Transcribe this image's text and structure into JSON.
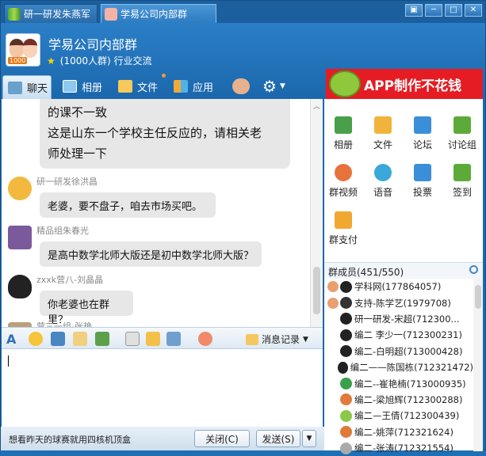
{
  "tabs": [
    {
      "label": "研一研发朱燕军"
    },
    {
      "label": "学易公司内部群"
    }
  ],
  "header": {
    "group_name": "学易公司内部群",
    "info": "(1000人群) 行业交流",
    "badge": "1000"
  },
  "toolbar": {
    "chat": "聊天",
    "album": "相册",
    "file": "文件",
    "apps": "应用"
  },
  "ad_banner": "APP制作不花钱",
  "messages": [
    {
      "sender": "",
      "text": [
        "的课不一致",
        "这是山东一个学校主任反应的，请相关老",
        "师处理一下"
      ]
    },
    {
      "sender": "研一研发徐洪昌",
      "text": "老婆，要不盘子，咱去市场买吧。"
    },
    {
      "sender": "精品组朱春光",
      "text": "是高中数学北师大版还是初中数学北师大版？"
    },
    {
      "sender": "zxxk营八-刘晶晶",
      "text": "你老婆也在群里？"
    },
    {
      "sender": "营三一组-张艳",
      "text": ""
    }
  ],
  "input": {
    "history_label": "消息记录"
  },
  "footer": {
    "ad_text": "想看昨天的球赛就用四核机顶盒",
    "close_label": "关闭(C)",
    "send_label": "发送(S)"
  },
  "apps": [
    {
      "label": "相册",
      "icon": "album-icon",
      "color": "#4aa04a"
    },
    {
      "label": "文件",
      "icon": "folder-icon",
      "color": "#f0b43c"
    },
    {
      "label": "论坛",
      "icon": "forum-icon",
      "color": "#3a8fd8"
    },
    {
      "label": "讨论组",
      "icon": "discussion-icon",
      "color": "#5cab3a"
    },
    {
      "label": "群视频",
      "icon": "video-icon",
      "color": "#e8733a"
    },
    {
      "label": "语音",
      "icon": "voice-icon",
      "color": "#3aa8d8"
    },
    {
      "label": "投票",
      "icon": "vote-icon",
      "color": "#3a8fd8"
    },
    {
      "label": "签到",
      "icon": "checkin-icon",
      "color": "#5cab3a"
    },
    {
      "label": "群支付",
      "icon": "pay-icon",
      "color": "#f0a830"
    }
  ],
  "members": {
    "header": "群成员(451/550)",
    "list": [
      "学科网(177864057)",
      "支持-陈学艺(1979708)",
      "研一研发-宋超(712300...",
      "编二 李少一(712300231)",
      "编二-白明超(713000428)",
      "编二——陈国栋(712321472)",
      "编二--崔艳楠(713000935)",
      "编二-梁旭辉(712300288)",
      "编二—王倩(712300439)",
      "编二-姚萍(712321624)",
      "编二-张涛(712321554)"
    ]
  }
}
